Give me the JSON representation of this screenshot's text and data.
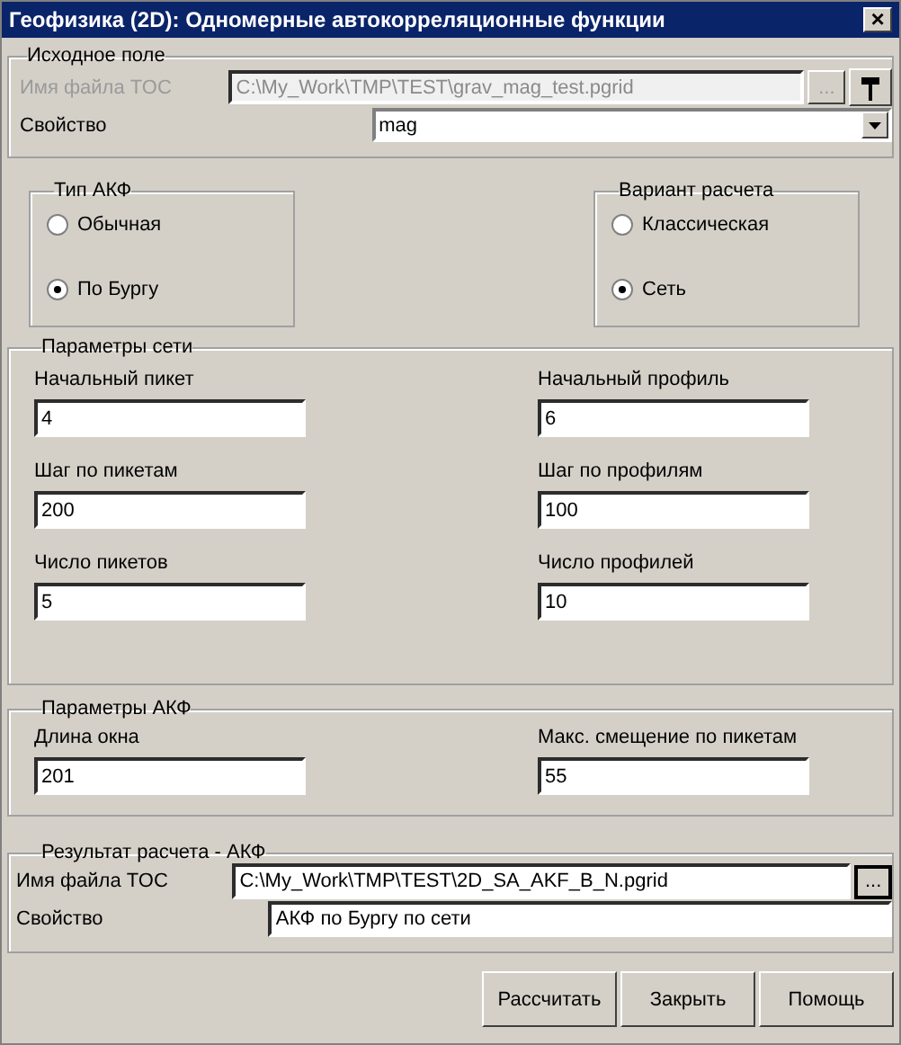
{
  "window": {
    "title": "Геофизика (2D): Одномерные автокорреляционные функции",
    "close": "×"
  },
  "source": {
    "legend": "Исходное поле",
    "file_label": "Имя файла TOC",
    "file_value": "C:\\My_Work\\TMP\\TEST\\grav_mag_test.pgrid",
    "browse": "...",
    "disabled": true,
    "property_label": "Свойство",
    "property_value": "mag"
  },
  "akf_type": {
    "legend": "Тип АКФ",
    "options": [
      {
        "label": "Обычная",
        "selected": false
      },
      {
        "label": "По Бургу",
        "selected": true
      }
    ]
  },
  "calc_variant": {
    "legend": "Вариант расчета",
    "options": [
      {
        "label": "Классическая",
        "selected": false
      },
      {
        "label": "Сеть",
        "selected": true
      }
    ]
  },
  "grid_params": {
    "legend": "Параметры сети",
    "fields": [
      {
        "label": "Начальный пикет",
        "value": "4"
      },
      {
        "label": "Начальный профиль",
        "value": "6"
      },
      {
        "label": "Шаг по пикетам",
        "value": "200"
      },
      {
        "label": "Шаг по профилям",
        "value": "100"
      },
      {
        "label": "Число пикетов",
        "value": "5"
      },
      {
        "label": "Число профилей",
        "value": "10"
      }
    ]
  },
  "akf_params": {
    "legend": "Параметры АКФ",
    "fields": [
      {
        "label": "Длина окна",
        "value": "201"
      },
      {
        "label": "Макс. смещение по пикетам",
        "value": "55"
      }
    ]
  },
  "result": {
    "legend": "Результат расчета - АКФ",
    "file_label": "Имя файла TOC",
    "file_value": "C:\\My_Work\\TMP\\TEST\\2D_SA_AKF_B_N.pgrid",
    "browse": "...",
    "property_label": "Свойство",
    "property_value": "АКФ по Бургу по сети"
  },
  "buttons": [
    "Рассчитать",
    "Закрыть",
    "Помощь"
  ]
}
